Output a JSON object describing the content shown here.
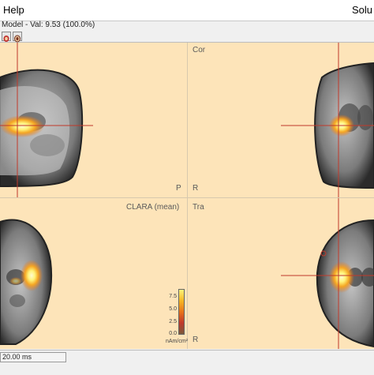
{
  "menubar": {
    "help_label": "Help",
    "right_label": "Solu"
  },
  "infobar": {
    "text": "Model - Val: 9.53 (100.0%)"
  },
  "toolbar": {
    "buttons": [
      {
        "icon": "head-icon"
      },
      {
        "icon": "head-outline-icon"
      }
    ]
  },
  "views": {
    "sagittal": {
      "orientation_p": "P",
      "orientation_r": "R"
    },
    "coronal": {
      "title": "Cor"
    },
    "axial": {
      "method": "CLARA (mean)"
    },
    "transverse": {
      "title": "Tra",
      "orientation_r": "R"
    }
  },
  "color_scale": {
    "ticks": [
      "7.5",
      "5.0",
      "2.5",
      "0.0"
    ],
    "unit": "nAm/cm²",
    "colors": [
      "#7a5a3a",
      "#c0392b",
      "#e8731a",
      "#f5b623",
      "#fff37a"
    ]
  },
  "colors": {
    "background": "#fde4b9",
    "crosshair": "#c0392b",
    "hotspot_core": "#fff37a",
    "hotspot_edge": "#e8731a"
  },
  "status": {
    "time": "20.00 ms"
  }
}
